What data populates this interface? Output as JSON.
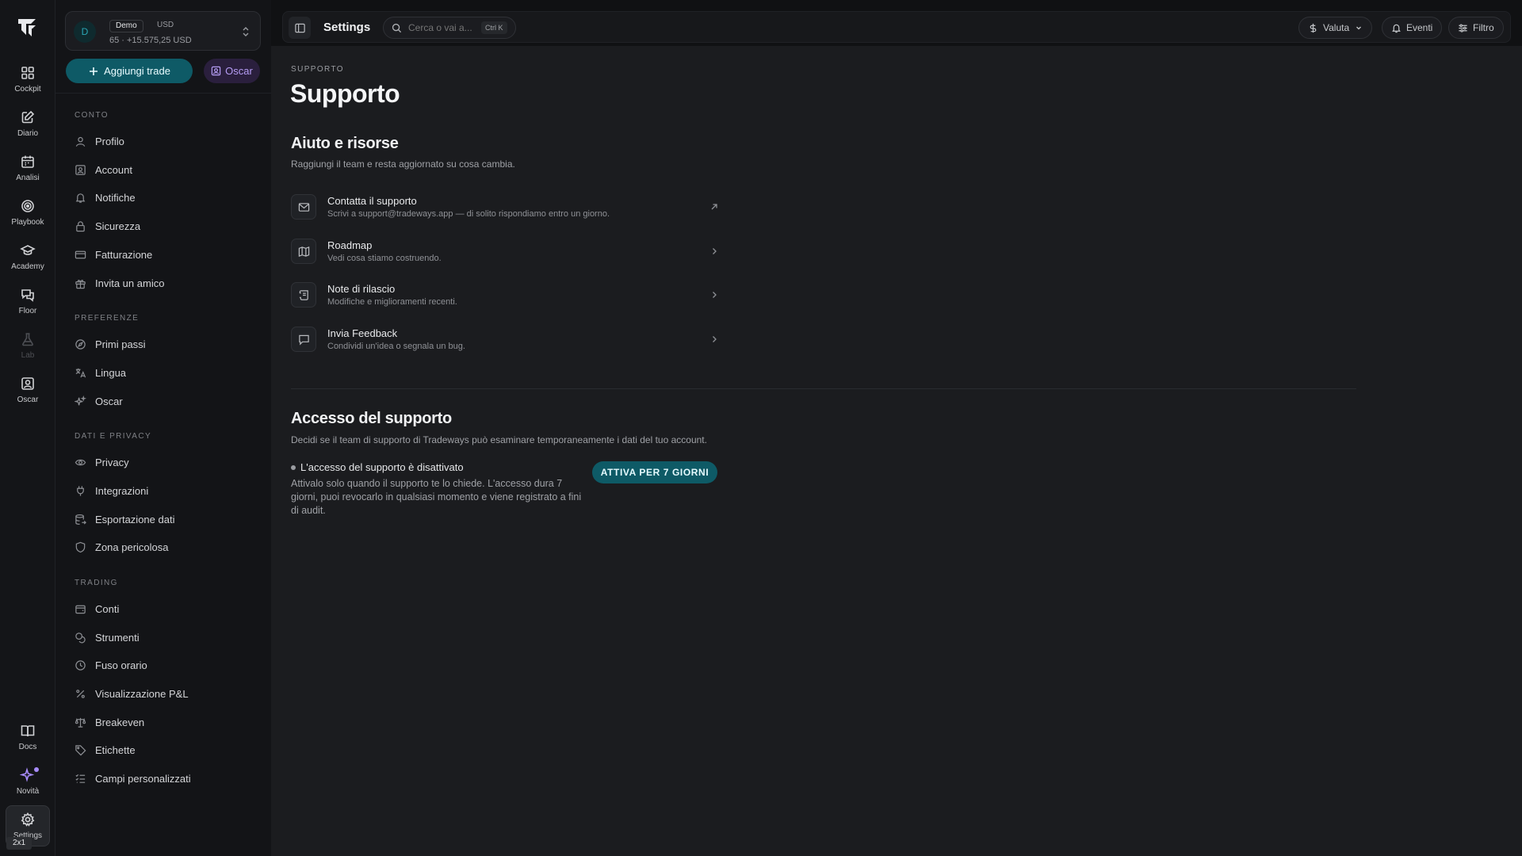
{
  "rail": {
    "items": [
      {
        "label": "Cockpit",
        "icon": "grid-icon"
      },
      {
        "label": "Diario",
        "icon": "edit-icon"
      },
      {
        "label": "Analisi",
        "icon": "calendar-icon"
      },
      {
        "label": "Playbook",
        "icon": "target-icon"
      },
      {
        "label": "Academy",
        "icon": "graduation-icon"
      },
      {
        "label": "Floor",
        "icon": "chat-icon"
      },
      {
        "label": "Lab",
        "icon": "flask-icon"
      },
      {
        "label": "Oscar",
        "icon": "oscar-icon"
      }
    ],
    "bottom": [
      {
        "label": "Docs",
        "icon": "book-icon"
      },
      {
        "label": "Novità",
        "icon": "sparkle-icon"
      },
      {
        "label": "Settings",
        "icon": "gear-icon"
      }
    ],
    "zoom_badge": "2x1"
  },
  "account": {
    "avatar": "D",
    "tag": "Demo",
    "currency": "USD",
    "summary": "65 · +15.575,25 USD"
  },
  "side_buttons": {
    "add_trade": "Aggiungi trade",
    "oscar": "Oscar"
  },
  "sidebar": {
    "sections": [
      {
        "title": "CONTO",
        "items": [
          "Profilo",
          "Account",
          "Notifiche",
          "Sicurezza",
          "Fatturazione",
          "Invita un amico"
        ]
      },
      {
        "title": "PREFERENZE",
        "items": [
          "Primi passi",
          "Lingua",
          "Oscar"
        ]
      },
      {
        "title": "DATI E PRIVACY",
        "items": [
          "Privacy",
          "Integrazioni",
          "Esportazione dati",
          "Zona pericolosa"
        ]
      },
      {
        "title": "TRADING",
        "items": [
          "Conti",
          "Strumenti",
          "Fuso orario",
          "Visualizzazione P&L",
          "Breakeven",
          "Etichette",
          "Campi personalizzati"
        ]
      }
    ]
  },
  "topbar": {
    "title": "Settings",
    "search_placeholder": "Cerca o vai a...",
    "search_kbd": "Ctrl K",
    "currency_btn": "Valuta",
    "events_btn": "Eventi",
    "filter_btn": "Filtro"
  },
  "page": {
    "eyebrow": "SUPPORTO",
    "title": "Supporto",
    "help": {
      "title": "Aiuto e risorse",
      "desc": "Raggiungi il team e resta aggiornato su cosa cambia.",
      "items": [
        {
          "title": "Contatta il supporto",
          "sub": "Scrivi a support@tradeways.app — di solito rispondiamo entro un giorno.",
          "icon": "mail-icon"
        },
        {
          "title": "Roadmap",
          "sub": "Vedi cosa stiamo costruendo.",
          "icon": "map-icon"
        },
        {
          "title": "Note di rilascio",
          "sub": "Modifiche e miglioramenti recenti.",
          "icon": "scroll-icon"
        },
        {
          "title": "Invia Feedback",
          "sub": "Condividi un'idea o segnala un bug.",
          "icon": "message-icon"
        }
      ]
    },
    "access": {
      "title": "Accesso del supporto",
      "desc": "Decidi se il team di supporto di Tradeways può esaminare temporaneamente i dati del tuo account.",
      "status": "L'accesso del supporto è disattivato",
      "body": "Attivalo solo quando il supporto te lo chiede. L'accesso dura 7 giorni, puoi revocarlo in qualsiasi momento e viene registrato a fini di audit.",
      "button": "ATTIVA PER 7 GIORNI"
    }
  },
  "colors": {
    "accent": "#0e5a66",
    "oscar": "#b59cf4",
    "background": "#1b1c1f"
  }
}
